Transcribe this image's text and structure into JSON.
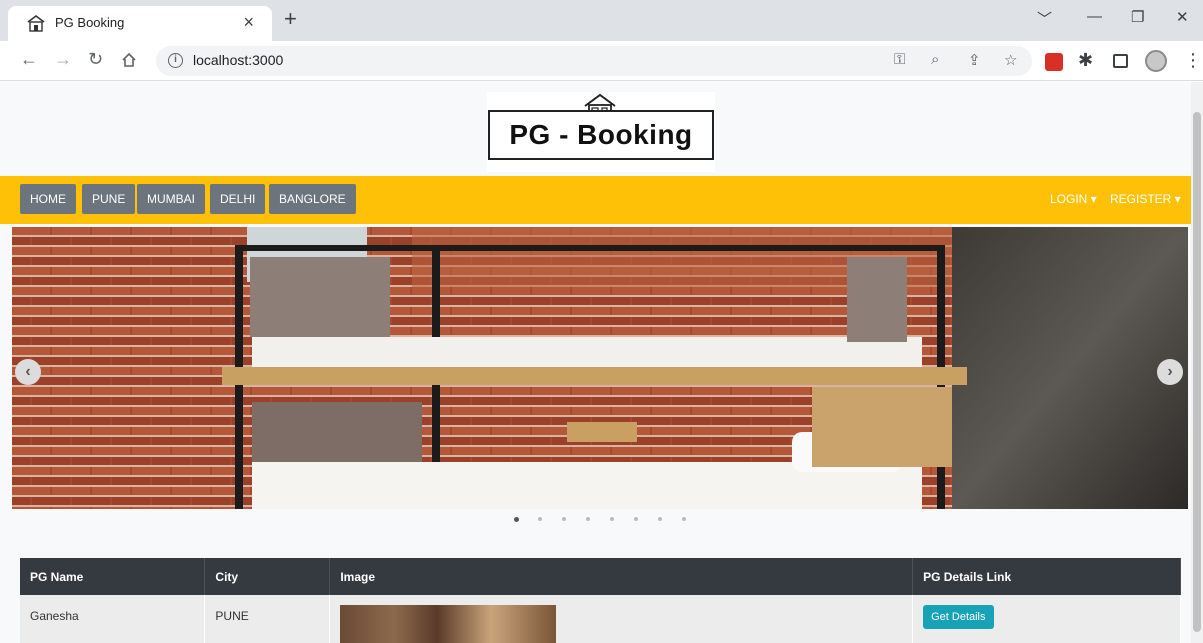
{
  "browser": {
    "tab_title": "PG Booking",
    "tab_close": "×",
    "new_tab": "+",
    "url": "localhost:3000",
    "window_controls": {
      "dropdown": "﹀",
      "minimize": "—",
      "restore": "❐",
      "close": "✕"
    }
  },
  "site": {
    "logo_text": "PG - Booking",
    "nav": {
      "links": [
        "HOME",
        "PUNE",
        "MUMBAI",
        "DELHI",
        "BANGLORE"
      ],
      "login": "LOGIN ▾",
      "register": "REGISTER ▾"
    },
    "carousel": {
      "prev": "‹",
      "next": "›",
      "slide_count": 8,
      "active_index": 0
    },
    "table": {
      "headers": [
        "PG Name",
        "City",
        "Image",
        "PG Details Link"
      ],
      "rows": [
        {
          "name": "Ganesha",
          "city": "PUNE",
          "button": "Get Details"
        }
      ]
    }
  },
  "colors": {
    "navbar": "#ffc107",
    "nav_button": "#6c757d",
    "table_header": "#343a40",
    "details_button": "#17a2b8"
  }
}
